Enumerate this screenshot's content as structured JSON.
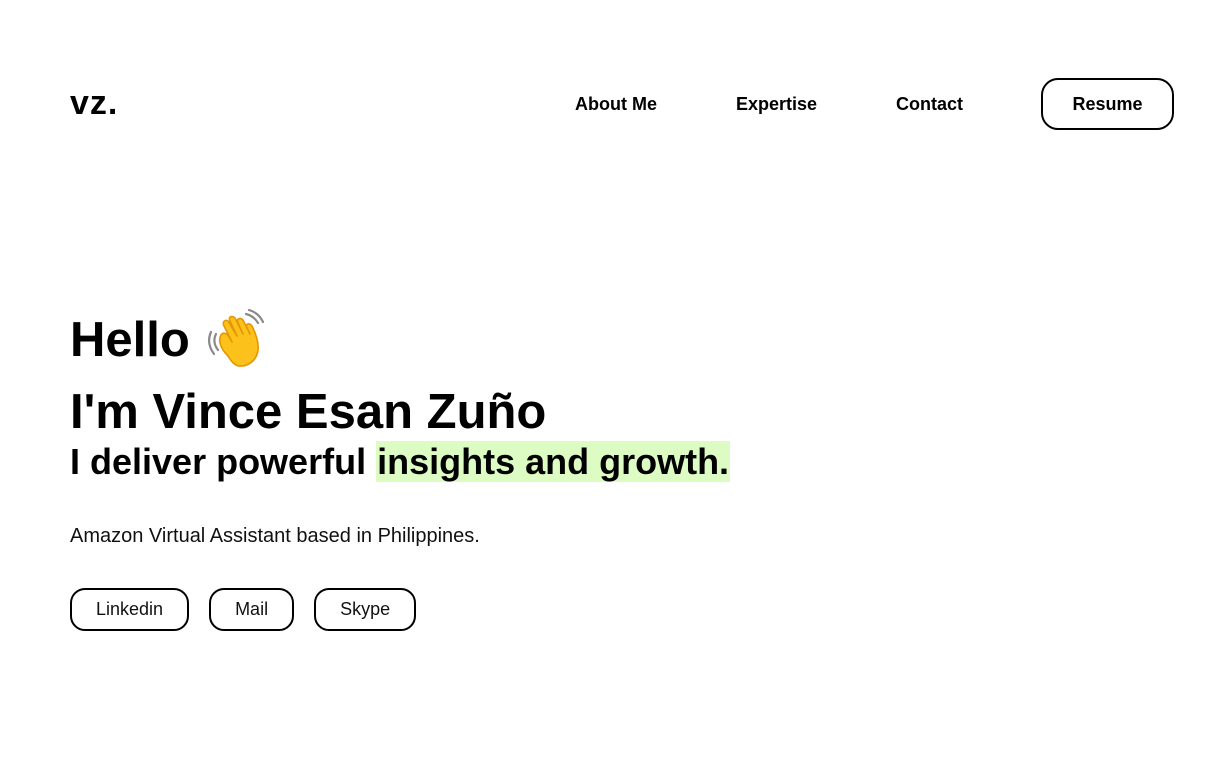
{
  "header": {
    "logo": "vz.",
    "nav": {
      "about": "About Me",
      "expertise": "Expertise",
      "contact": "Contact"
    },
    "resume_label": "Resume"
  },
  "hero": {
    "hello": "Hello",
    "wave_icon": "waving-hand-icon",
    "name": "I'm Vince Esan Zuño",
    "tagline_prefix": "I deliver powerful ",
    "tagline_highlight": "insights and growth.",
    "highlight_color": "#dcfcc3",
    "subtitle": "Amazon Virtual Assistant based in Philippines."
  },
  "socials": {
    "linkedin": "Linkedin",
    "mail": "Mail",
    "skype": "Skype"
  }
}
